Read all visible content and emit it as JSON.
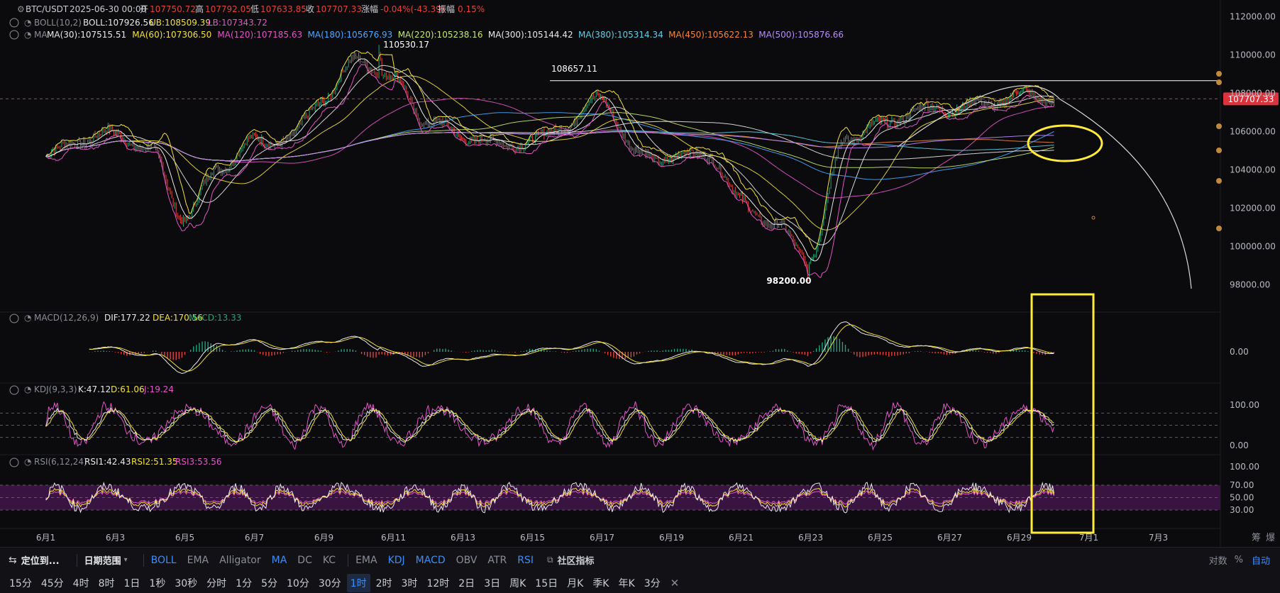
{
  "colors": {
    "bg": "#0b0b0d",
    "up": "#26a17b",
    "down": "#e0443e",
    "text": "#c9ccd3",
    "accent": "#3d8df5",
    "annot": "#ffeb3b",
    "price_tag": "#d9343e"
  },
  "header": {
    "symbol": "BTC/USDT",
    "datetime": "2025-06-30 00:00",
    "open_label": "开",
    "open": "107750.72",
    "high_label": "高",
    "high": "107792.05",
    "low_label": "低",
    "low": "107633.85",
    "close_label": "收",
    "close": "107707.33",
    "change_label": "涨幅",
    "change": "-0.04%(-43.39)",
    "amp_label": "振幅",
    "amp": "0.15%"
  },
  "boll": {
    "name": "BOLL(10,2)",
    "mid": "BOLL:107926.56",
    "ub": "UB:108509.39",
    "lb": "LB:107343.72"
  },
  "ma": {
    "name": "MA",
    "items": [
      {
        "text": "MA(30):107515.51",
        "color": "#e8e8e8"
      },
      {
        "text": "MA(60):107306.50",
        "color": "#f2e03a"
      },
      {
        "text": "MA(120):107185.63",
        "color": "#e255c8"
      },
      {
        "text": "MA(180):105676.93",
        "color": "#4aa8ff"
      },
      {
        "text": "MA(220):105238.16",
        "color": "#c4e86a"
      },
      {
        "text": "MA(300):105144.42",
        "color": "#e8e8e8"
      },
      {
        "text": "MA(380):105314.34",
        "color": "#5fd0e8"
      },
      {
        "text": "MA(450):105622.13",
        "color": "#f0873c"
      },
      {
        "text": "MA(500):105876.66",
        "color": "#b98cff"
      }
    ]
  },
  "macd": {
    "name": "MACD(12,26,9)",
    "dif": "DIF:177.22",
    "dea": "DEA:170.56",
    "macd": "MACD:13.33"
  },
  "kdj": {
    "name": "KDJ(9,3,3)",
    "k": "K:47.12",
    "d": "D:61.06",
    "j": "J:19.24"
  },
  "rsi": {
    "name": "RSI(6,12,24)",
    "r1": "RSI1:42.43",
    "r2": "RSI2:51.35",
    "r3": "RSI3:53.56"
  },
  "annotations": {
    "high": "110530.17",
    "low": "98200.00",
    "resistance": "108657.11",
    "current": "107707.33"
  },
  "right_corner": {
    "a": "筹",
    "b": "爆"
  },
  "toolbar": {
    "locate": "定位到...",
    "date_range": "日期范围",
    "indicators": [
      {
        "label": "BOLL",
        "active": true
      },
      {
        "label": "EMA",
        "active": false
      },
      {
        "label": "Alligator",
        "active": false
      },
      {
        "label": "MA",
        "active": true
      },
      {
        "label": "DC",
        "active": false
      },
      {
        "label": "KC",
        "active": false
      }
    ],
    "sub_indicators": [
      {
        "label": "EMA",
        "active": false
      },
      {
        "label": "KDJ",
        "active": true
      },
      {
        "label": "MACD",
        "active": true
      },
      {
        "label": "OBV",
        "active": false
      },
      {
        "label": "ATR",
        "active": false
      },
      {
        "label": "RSI",
        "active": true
      }
    ],
    "community": "社区指标",
    "log": "对数",
    "pct": "%",
    "auto": "自动"
  },
  "intervals": [
    {
      "label": "15分",
      "active": false
    },
    {
      "label": "45分",
      "active": false
    },
    {
      "label": "4时",
      "active": false
    },
    {
      "label": "8时",
      "active": false
    },
    {
      "label": "1日",
      "active": false
    },
    {
      "label": "1秒",
      "active": false
    },
    {
      "label": "30秒",
      "active": false
    },
    {
      "label": "分时",
      "active": false
    },
    {
      "label": "1分",
      "active": false
    },
    {
      "label": "5分",
      "active": false
    },
    {
      "label": "10分",
      "active": false
    },
    {
      "label": "30分",
      "active": false
    },
    {
      "label": "1时",
      "active": true
    },
    {
      "label": "2时",
      "active": false
    },
    {
      "label": "3时",
      "active": false
    },
    {
      "label": "12时",
      "active": false
    },
    {
      "label": "2日",
      "active": false
    },
    {
      "label": "3日",
      "active": false
    },
    {
      "label": "周K",
      "active": false
    },
    {
      "label": "15日",
      "active": false
    },
    {
      "label": "月K",
      "active": false
    },
    {
      "label": "季K",
      "active": false
    },
    {
      "label": "年K",
      "active": false
    },
    {
      "label": "3分",
      "active": false
    }
  ],
  "chart_data": {
    "type": "line",
    "title": "BTC/USDT",
    "price_axis": {
      "ticks": [
        98000,
        100000,
        102000,
        104000,
        106000,
        108000,
        110000,
        112000
      ],
      "range": [
        97500,
        112500
      ]
    },
    "macd_axis": {
      "ticks": [
        "0.00"
      ]
    },
    "kdj_axis": {
      "ticks": [
        "100.00",
        "0.00"
      ]
    },
    "rsi_axis": {
      "ticks": [
        "100.00",
        "70.00",
        "50.00",
        "30.00"
      ]
    },
    "x_ticks": [
      "6月1",
      "6月3",
      "6月5",
      "6月7",
      "6月9",
      "6月11",
      "6月13",
      "6月15",
      "6月17",
      "6月19",
      "6月21",
      "6月23",
      "6月25",
      "6月27",
      "6月29",
      "7月1",
      "7月3"
    ],
    "x_range": [
      "6月1",
      "7月3"
    ],
    "series": [
      {
        "name": "close",
        "x": [
          "6月1",
          "6月2",
          "6月3",
          "6月4",
          "6月5",
          "6月6",
          "6月7",
          "6月8",
          "6月9",
          "6月10",
          "6月11",
          "6月12",
          "6月13",
          "6月14",
          "6月15",
          "6月16",
          "6月17",
          "6月18",
          "6月19",
          "6月20",
          "6月21",
          "6月22",
          "6月23",
          "6月24",
          "6月25",
          "6月26",
          "6月27",
          "6月28",
          "6月29",
          "6月30"
        ],
        "values": [
          104700,
          105600,
          105900,
          105000,
          101500,
          104200,
          105500,
          105600,
          107800,
          109800,
          108700,
          106500,
          105800,
          105300,
          105500,
          106400,
          107800,
          104800,
          104600,
          104900,
          102400,
          101000,
          99500,
          105700,
          106300,
          107100,
          107200,
          107400,
          107900,
          107707
        ]
      }
    ],
    "extremes": {
      "high": {
        "x": "6月10",
        "value": 110530.17
      },
      "low": {
        "x": "6月23",
        "value": 98200.0
      }
    },
    "resistance": 108657.11,
    "current": 107707.33,
    "rsi_band": [
      30,
      70
    ],
    "kdj_levels": [
      20,
      50,
      80
    ]
  }
}
